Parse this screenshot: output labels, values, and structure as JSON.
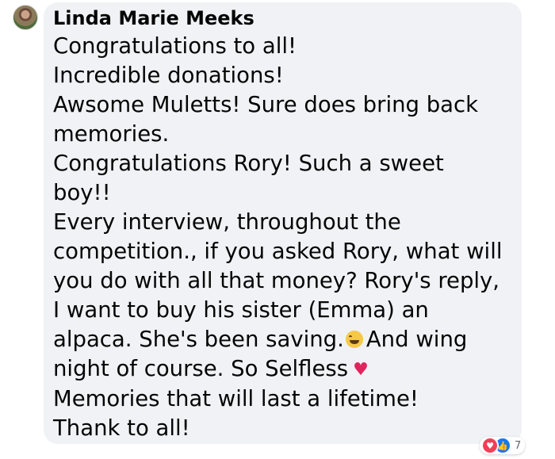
{
  "comment": {
    "author": "Linda Marie Meeks",
    "lines": [
      "Congratulations to all!",
      "Incredible donations!",
      "Awsome Muletts! Sure does bring back",
      "memories.",
      "Congratulations Rory! Such a sweet",
      "boy!!",
      "Every interview, throughout the",
      "competition., if you asked Rory, what will",
      "you do with all that money? Rory's reply,",
      "I want to buy his sister (Emma) an",
      "alpaca. She's been saving.",
      "And wing",
      "night of course. So Selfless",
      "Memories that will last a lifetime!",
      "Thank to all!"
    ],
    "emojis": {
      "laugh": "grinning-sweat-emoji",
      "heart": "♥"
    }
  },
  "reactions": {
    "count": "7",
    "types": [
      "love-icon",
      "like-icon"
    ],
    "colors": {
      "love": "#f33e58",
      "like": "#1877f2"
    }
  },
  "colors": {
    "bubble_background": "#f0f2f5",
    "text": "#050505",
    "secondary_text": "#65676b"
  }
}
